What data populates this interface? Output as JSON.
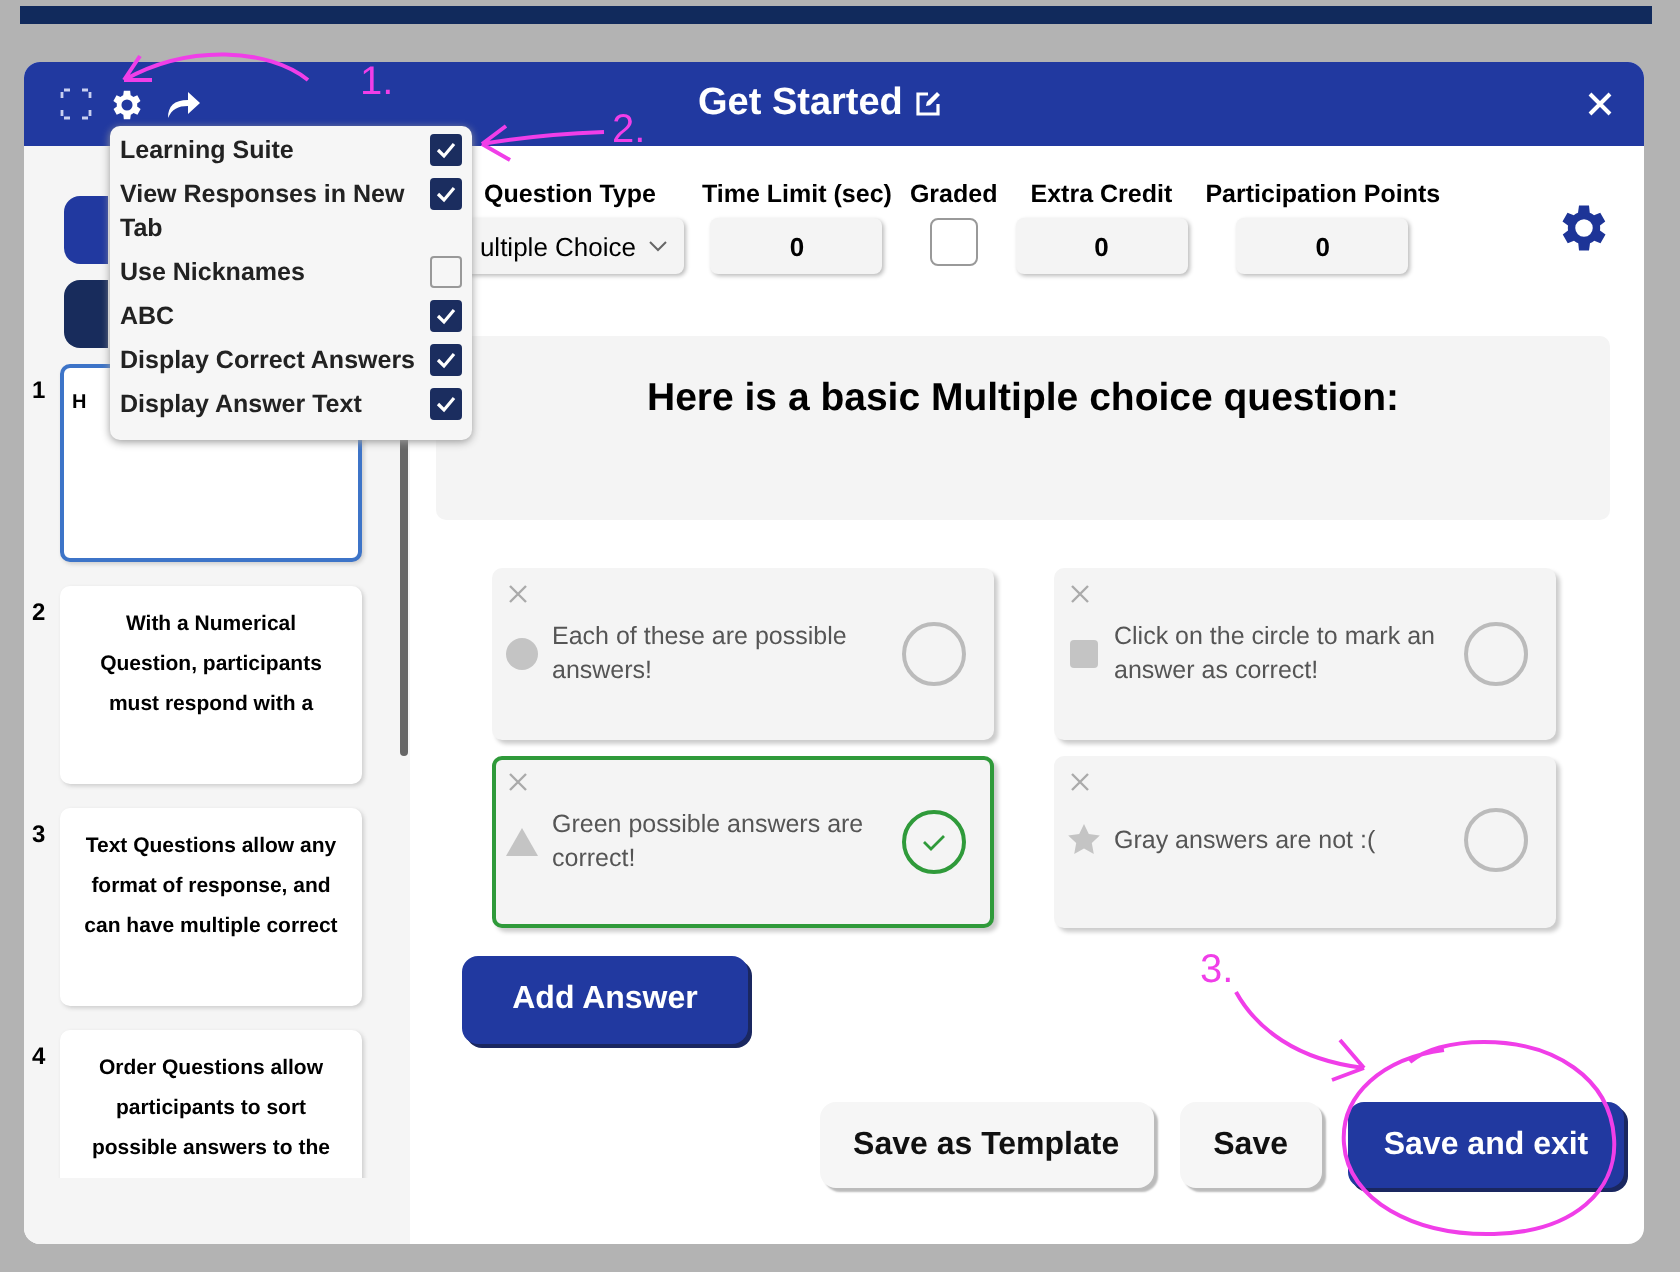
{
  "window": {
    "title": "Get Started"
  },
  "settings_menu": [
    {
      "label": "Learning Suite",
      "checked": true
    },
    {
      "label": "View Responses in New Tab",
      "checked": true
    },
    {
      "label": "Use Nicknames",
      "checked": false
    },
    {
      "label": "ABC",
      "checked": true
    },
    {
      "label": "Display Correct Answers",
      "checked": true
    },
    {
      "label": "Display Answer Text",
      "checked": true
    }
  ],
  "questions": [
    {
      "number": "1",
      "text": "H",
      "selected": true
    },
    {
      "number": "2",
      "text": "With a Numerical Question, participants must respond with a",
      "selected": false
    },
    {
      "number": "3",
      "text": "Text Questions allow any format of response, and can have multiple correct",
      "selected": false
    },
    {
      "number": "4",
      "text": "Order Questions allow participants to sort possible answers to the",
      "selected": false
    }
  ],
  "fields": [
    {
      "kind": "select",
      "label": "Question Type",
      "value": "ultiple Choice"
    },
    {
      "kind": "number",
      "label": "Time Limit (sec)",
      "value": "0"
    },
    {
      "kind": "checkbox",
      "label": "Graded",
      "checked": false
    },
    {
      "kind": "number",
      "label": "Extra Credit",
      "value": "0"
    },
    {
      "kind": "number",
      "label": "Participation Points",
      "value": "0"
    }
  ],
  "question_text": "Here is a basic Multiple choice question:",
  "answers": [
    {
      "kind": "circle",
      "text": "Each of these are possible answers!",
      "correct": false
    },
    {
      "kind": "square",
      "text": "Click on the circle to mark an answer as correct!",
      "correct": false
    },
    {
      "kind": "triangle",
      "text": "Green possible answers are correct!",
      "correct": true
    },
    {
      "kind": "star",
      "text": "Gray answers are not :(",
      "correct": false
    }
  ],
  "add_answer": "Add Answer",
  "buttons": [
    {
      "label": "Save as Template",
      "primary": false
    },
    {
      "label": "Save",
      "primary": false
    },
    {
      "label": "Save and exit",
      "primary": true
    }
  ],
  "annotations": [
    "1.",
    "2.",
    "3."
  ]
}
